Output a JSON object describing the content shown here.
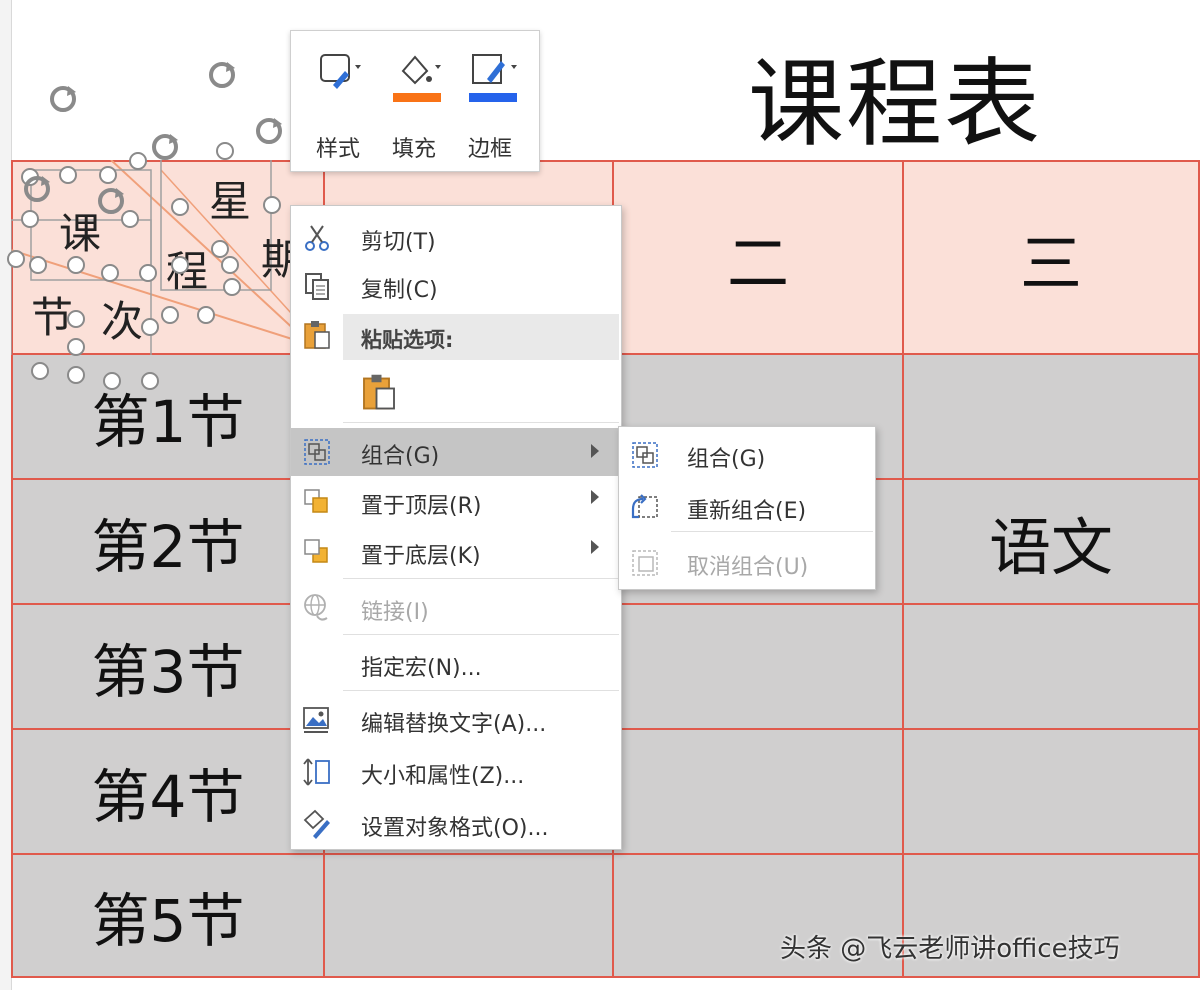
{
  "title": "课程表",
  "diagonal_header": {
    "chars": [
      "课",
      "程",
      "星",
      "期",
      "节",
      "次"
    ]
  },
  "header_row": [
    "",
    "二",
    "三"
  ],
  "rows": [
    {
      "label": "第1节",
      "cells": [
        "",
        "",
        ""
      ]
    },
    {
      "label": "第2节",
      "cells": [
        "",
        "",
        "语文"
      ]
    },
    {
      "label": "第3节",
      "cells": [
        "",
        "",
        ""
      ]
    },
    {
      "label": "第4节",
      "cells": [
        "",
        "",
        ""
      ]
    },
    {
      "label": "第5节",
      "cells": [
        "",
        "",
        ""
      ]
    }
  ],
  "mini_toolbar": {
    "style_label": "样式",
    "fill_label": "填充",
    "border_label": "边框",
    "fill_color": "#f97316",
    "border_color": "#2563eb"
  },
  "context_menu": {
    "cut": "剪切(T)",
    "copy": "复制(C)",
    "paste_options": "粘贴选项:",
    "group": "组合(G)",
    "bring_to_front": "置于顶层(R)",
    "send_to_back": "置于底层(K)",
    "link": "链接(I)",
    "assign_macro": "指定宏(N)...",
    "edit_alt_text": "编辑替换文字(A)...",
    "size_properties": "大小和属性(Z)...",
    "format_object": "设置对象格式(O)..."
  },
  "group_submenu": {
    "group": "组合(G)",
    "regroup": "重新组合(E)",
    "ungroup": "取消组合(U)"
  },
  "watermark": "头条 @飞云老师讲office技巧",
  "colors": {
    "grid_border": "#e05a4c",
    "header_fill": "#fbe0d8",
    "body_fill": "#d0cfcf",
    "menu_highlight": "#c5c5c5"
  }
}
